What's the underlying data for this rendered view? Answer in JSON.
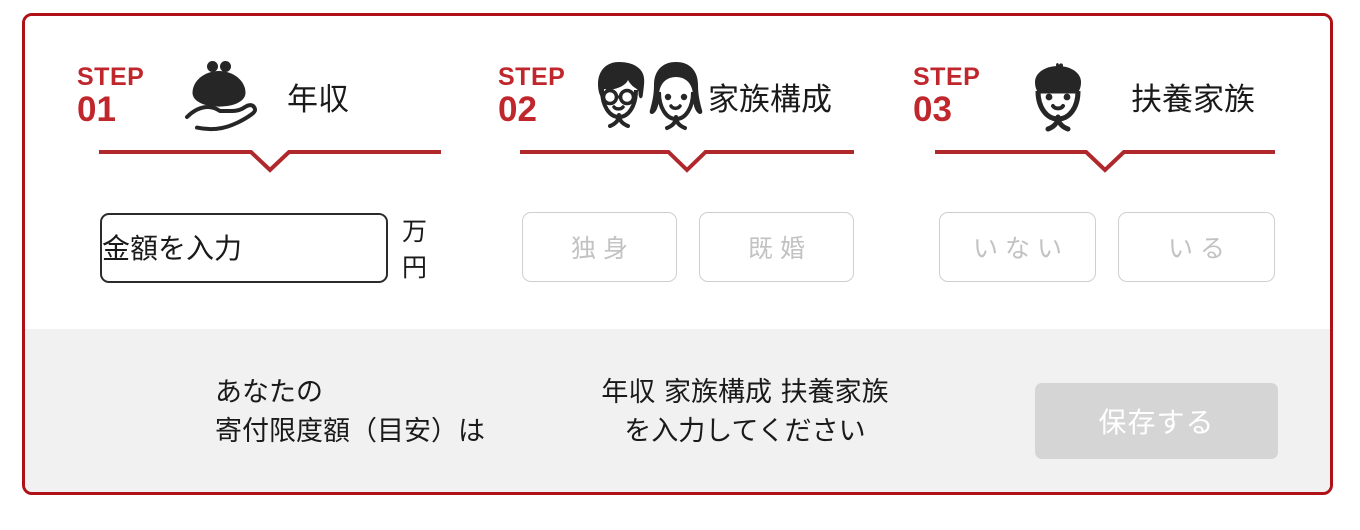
{
  "theme": {
    "border_color": "#b01117",
    "accent_red": "#c0272d",
    "footer_bg": "#f1f1f1",
    "disabled_button_bg": "#d5d5d5",
    "disabled_text": "#c2c2c2"
  },
  "steps": [
    {
      "step_label": "STEP",
      "step_number": "01",
      "icon": "purse-on-hand-icon",
      "title": "年収",
      "input": {
        "type": "text",
        "placeholder": "金額を入力",
        "value": "",
        "unit": "万円"
      }
    },
    {
      "step_label": "STEP",
      "step_number": "02",
      "icon": "couple-faces-icon",
      "title": "家族構成",
      "options": [
        "独身",
        "既婚"
      ]
    },
    {
      "step_label": "STEP",
      "step_number": "03",
      "icon": "child-face-icon",
      "title": "扶養家族",
      "options": [
        "いない",
        "いる"
      ]
    }
  ],
  "footer": {
    "result_label_line1": "あなたの",
    "result_label_line2": "寄付限度額（目安）は",
    "message_line1": "年収 家族構成 扶養家族",
    "message_line2": "を入力してください",
    "save_button": "保存する"
  }
}
